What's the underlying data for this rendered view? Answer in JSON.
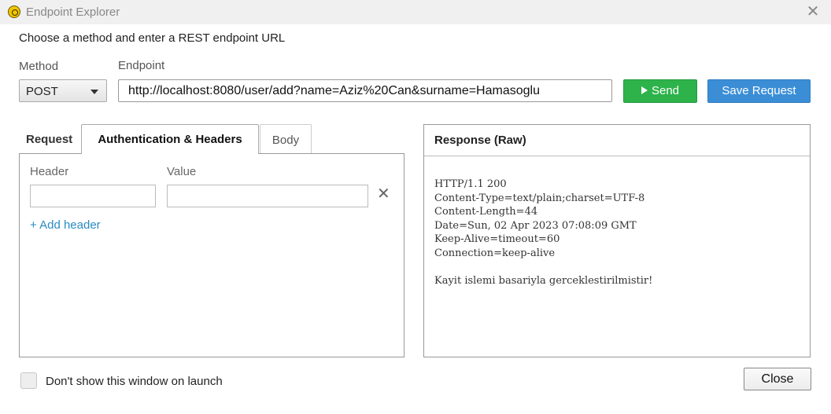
{
  "window": {
    "title": "Endpoint Explorer",
    "app_icon": "target-icon",
    "close_icon": "close-icon"
  },
  "instruction": "Choose a method and enter a REST endpoint URL",
  "form": {
    "method_label": "Method",
    "endpoint_label": "Endpoint",
    "method_value": "POST",
    "endpoint_value": "http://localhost:8080/user/add?name=Aziz%20Can&surname=Hamasoglu",
    "send_label": "Send",
    "save_label": "Save Request",
    "send_color": "#2db34a",
    "save_color": "#3b8ed6"
  },
  "request": {
    "section_label": "Request",
    "tabs": [
      {
        "label": "Authentication & Headers",
        "active": true
      },
      {
        "label": "Body",
        "active": false
      }
    ],
    "header_col": "Header",
    "value_col": "Value",
    "header_value": "",
    "value_value": "",
    "add_header": "+ Add header"
  },
  "response": {
    "title": "Response (Raw)",
    "body": "HTTP/1.1 200\nContent-Type=text/plain;charset=UTF-8\nContent-Length=44\nDate=Sun, 02 Apr 2023 07:08:09 GMT\nKeep-Alive=timeout=60\nConnection=keep-alive\n\nKayit islemi basariyla gerceklestirilmistir!"
  },
  "footer": {
    "checkbox_label": "Don't show this window on launch",
    "checkbox_checked": false,
    "close_label": "Close"
  }
}
